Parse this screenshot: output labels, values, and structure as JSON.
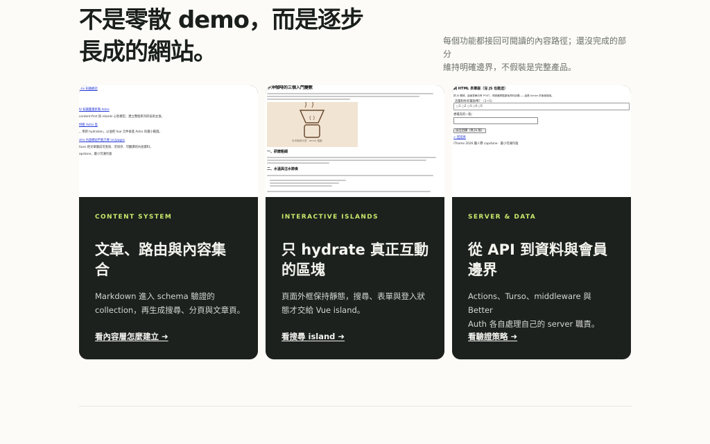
{
  "hero": {
    "title_line1": "不是零散 demo，而是逐步",
    "title_line2": "長成的網站。",
    "note_line1": "每個功能都接回可閱讀的內容路徑；還沒完成的部分",
    "note_line2": "維持明確邊界，不假裝是完整產品。"
  },
  "cards": [
    {
      "eyebrow": "CONTENT SYSTEM",
      "title_line1": "文章、路由與內容集",
      "title_line2": "合",
      "desc_line1": "Markdown 進入 schema 驗證的",
      "desc_line2": "collection，再生成搜尋、分頁與文章頁。",
      "link": "看內容層怎麼建立 ➜",
      "shot": {
        "lines": [
          ".mx 知識網誌",
          "Ⅳ 知識層重新看 Astro",
          "content-first 與 islands 心智模型，建立整個系列的技術主張。",
          "例看 Astro 島",
          "，用新 hydration，以並把 Vue 元件接進 Astro 的最小範圍。",
          "stro 內容網站不能只要 src/pages",
          "tions 把文章變成可查詢、可排序、可翻譯的內容資料。",
          "apstone，最小可運作版"
        ]
      }
    },
    {
      "eyebrow": "INTERACTIVE ISLANDS",
      "title_line1": "只 hydrate 真正互動",
      "title_line2": "的區塊",
      "desc_line1": "頁面外框保持靜態，搜尋、表單與登入狀",
      "desc_line2": "態才交給 Vue island。",
      "link": "看搜尋 island ➜",
      "shot": {
        "heading": "手沖咖啡的三個入門變數",
        "caption": "手沖咖啡示意 · demo 插圖",
        "section1": "一、研磨粗細",
        "section2": "二、水溫與注水節奏"
      }
    },
    {
      "eyebrow": "SERVER & DATA",
      "title_line1": "從 API 到資料與會員",
      "title_line2": "邊界",
      "desc_line1": "Actions、Turso、middleware 與 Better",
      "desc_line2": "Auth 各自處理自己的 server 職責。",
      "link": "看驗證策略 ➜",
      "shot": {
        "heading": "純 HTML 表單版（沒 JS 也能送）",
        "lines": [
          "把 JS 關掉，這個表單仍會 POST，伺服器把驗證後資料回傳——這是 Action 的漸進增強。",
          "這篇對你有幫助嗎？（1~5）",
          "○1 ○2 ○3 ○4 ○5",
          "想補充的一點：",
          "送出回饋（無 JS 版）",
          "← 回首頁",
          "iThome 2026 鐵人賽 capstone · 最小可運作版"
        ]
      }
    }
  ],
  "colors": {
    "background": "#fcfbf7",
    "card": "#1c211e",
    "accent": "#c8e86a"
  }
}
